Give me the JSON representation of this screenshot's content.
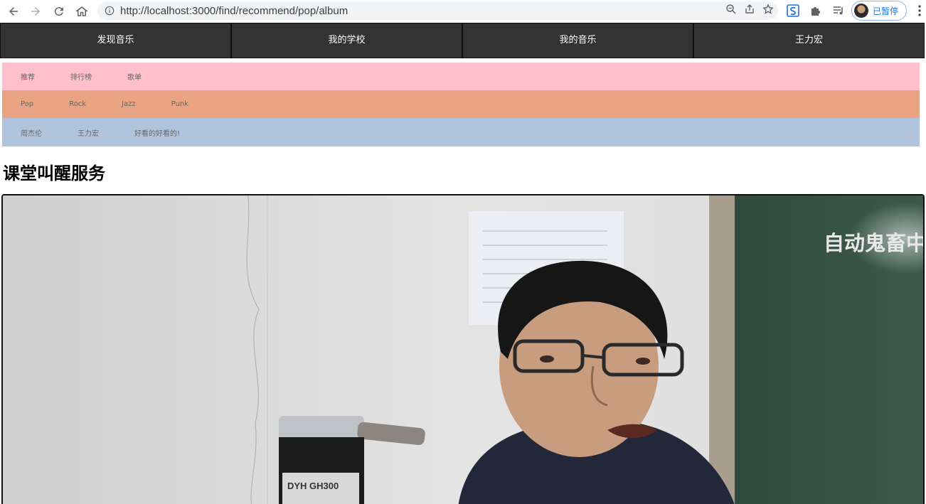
{
  "browser": {
    "url": "http://localhost:3000/find/recommend/pop/album",
    "profile_label": "已暂停"
  },
  "top_nav": {
    "items": [
      "发现音乐",
      "我的学校",
      "我的音乐",
      "王力宏"
    ]
  },
  "sub_nav": {
    "row1": [
      "推荐",
      "排行榜",
      "歌单"
    ],
    "row2": [
      "Pop",
      "Rock",
      "Jazz",
      "Punk"
    ],
    "row3": [
      "周杰伦",
      "王力宏",
      "好看的好看的!"
    ]
  },
  "main": {
    "title": "课堂叫醒服务",
    "video": {
      "danmaku": "自动鬼畜中",
      "projector_label": "DYH GH300"
    }
  },
  "colors": {
    "nav_bg": "#333333",
    "row1_bg": "#ffc0cb",
    "row2_bg": "#e9a382",
    "row3_bg": "#b0c4de"
  }
}
